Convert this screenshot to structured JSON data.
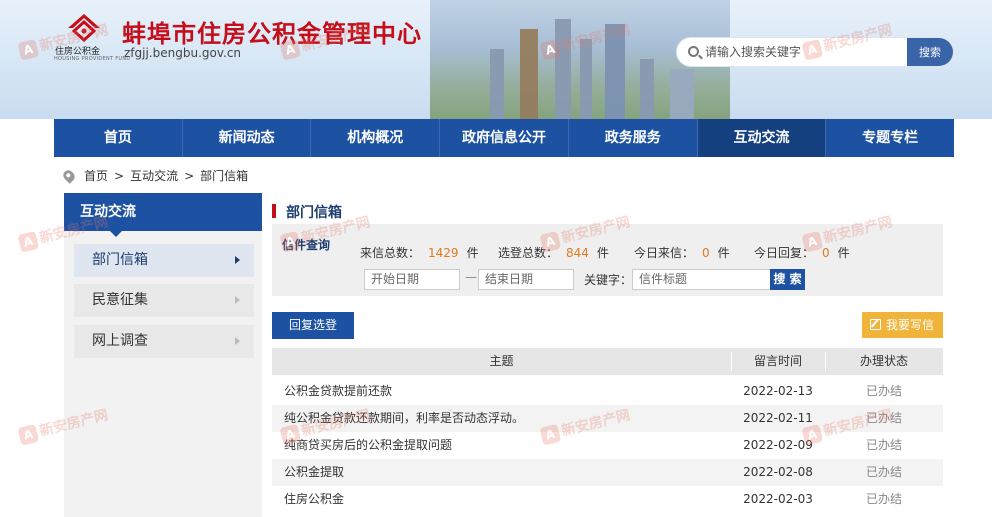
{
  "header": {
    "title": "蚌埠市住房公积金管理中心",
    "domain": "zfgjj.bengbu.gov.cn",
    "logo_text": "住房公积金",
    "logo_sub": "HOUSING PROVIDENT FUND",
    "search_placeholder": "请输入搜索关键字",
    "search_button": "搜索"
  },
  "nav": {
    "items": [
      "首页",
      "新闻动态",
      "机构概况",
      "政府信息公开",
      "政务服务",
      "互动交流",
      "专题专栏"
    ],
    "active_index": 5
  },
  "breadcrumb": {
    "items": [
      "首页",
      "互动交流",
      "部门信箱"
    ],
    "separator": ">"
  },
  "sidebar": {
    "title": "互动交流",
    "items": [
      "部门信箱",
      "民意征集",
      "网上调查"
    ],
    "active_index": 0
  },
  "main": {
    "title": "部门信箱",
    "query": {
      "label": "信件查询",
      "total_label": "来信总数：",
      "total_value": "1429",
      "total_unit": "件",
      "selected_label": "选登总数：",
      "selected_value": "844",
      "selected_unit": "件",
      "today_in_label": "今日来信：",
      "today_in_value": "0",
      "today_in_unit": "件",
      "today_reply_label": "今日回复：",
      "today_reply_value": "0",
      "today_reply_unit": "件",
      "start_date_placeholder": "开始日期",
      "end_date_placeholder": "结束日期",
      "date_separator": "—",
      "keyword_label": "关键字：",
      "keyword_placeholder": "信件标题",
      "search_button": "搜 索"
    },
    "reply_button": "回复选登",
    "write_button": "我要写信",
    "table": {
      "headers": [
        "主题",
        "留言时间",
        "办理状态"
      ],
      "rows": [
        {
          "subject": "公积金贷款提前还款",
          "date": "2022-02-13",
          "status": "已办结"
        },
        {
          "subject": "纯公积金贷款还款期间，利率是否动态浮动。",
          "date": "2022-02-11",
          "status": "已办结"
        },
        {
          "subject": "纯商贷买房后的公积金提取问题",
          "date": "2022-02-09",
          "status": "已办结"
        },
        {
          "subject": "公积金提取",
          "date": "2022-02-08",
          "status": "已办结"
        },
        {
          "subject": "住房公积金",
          "date": "2022-02-03",
          "status": "已办结"
        }
      ]
    }
  },
  "watermark": {
    "text": "新安房产网",
    "sub": "www.xafc.com",
    "icon": "A"
  },
  "colors": {
    "brand_red": "#c40e1a",
    "nav_blue": "#1d52a3",
    "accent_orange": "#e07a1f",
    "write_button": "#f0b43a"
  }
}
